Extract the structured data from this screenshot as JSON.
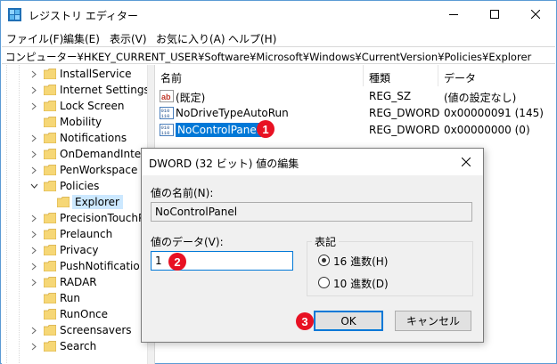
{
  "window": {
    "title": "レジストリ エディター",
    "controls": {
      "minimize": "minimize-icon",
      "maximize": "maximize-icon",
      "close": "close-icon"
    }
  },
  "menu": [
    {
      "label": "ファイル(F)"
    },
    {
      "label": "編集(E)"
    },
    {
      "label": "表示(V)"
    },
    {
      "label": "お気に入り(A)"
    },
    {
      "label": "ヘルプ(H)"
    }
  ],
  "address": "コンピューター¥HKEY_CURRENT_USER¥Software¥Microsoft¥Windows¥CurrentVersion¥Policies¥Explorer",
  "tree": {
    "items": [
      {
        "label": "InstallService"
      },
      {
        "label": "Internet Settings"
      },
      {
        "label": "Lock Screen"
      },
      {
        "label": "Mobility"
      },
      {
        "label": "Notifications"
      },
      {
        "label": "OnDemandInter"
      },
      {
        "label": "PenWorkspace"
      },
      {
        "label": "Policies"
      },
      {
        "label": "Explorer"
      },
      {
        "label": "PrecisionTouchP"
      },
      {
        "label": "Prelaunch"
      },
      {
        "label": "Privacy"
      },
      {
        "label": "PushNotificatio"
      },
      {
        "label": "RADAR"
      },
      {
        "label": "Run"
      },
      {
        "label": "RunOnce"
      },
      {
        "label": "Screensavers"
      },
      {
        "label": "Search"
      }
    ]
  },
  "list": {
    "columns": {
      "name": "名前",
      "type": "種類",
      "data": "データ"
    },
    "rows": [
      {
        "name": "(既定)",
        "type": "REG_SZ",
        "data": "(値の設定なし)",
        "icon": "string-value-icon"
      },
      {
        "name": "NoDriveTypeAutoRun",
        "type": "REG_DWORD",
        "data": "0x00000091 (145)",
        "icon": "binary-value-icon"
      },
      {
        "name": "NoControlPanel",
        "type": "REG_DWORD",
        "data": "0x00000000 (0)",
        "icon": "binary-value-icon"
      }
    ]
  },
  "dialog": {
    "title": "DWORD (32 ビット) 値の編集",
    "value_name_label": "値の名前(N):",
    "value_name": "NoControlPanel",
    "value_data_label": "値のデータ(V):",
    "value_data": "1",
    "base_label": "表記",
    "base_hex": "16 進数(H)",
    "base_dec": "10 進数(D)",
    "base_selected": "16 進数(H)",
    "ok": "OK",
    "cancel": "キャンセル"
  },
  "badges": {
    "one": "1",
    "two": "2",
    "three": "3"
  },
  "colors": {
    "badge": "#e81123",
    "selection": "#0078d7",
    "folder": "#f6d776",
    "accent_border": "#0078d7"
  }
}
